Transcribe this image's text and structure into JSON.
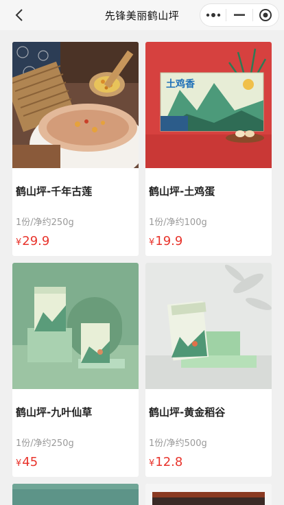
{
  "navbar": {
    "title": "先锋美丽鹤山坪",
    "back_icon": "chevron-left-icon",
    "more_icon": "more-dots-icon",
    "minimize_icon": "minus-icon",
    "close_icon": "target-circle-icon"
  },
  "products": [
    {
      "name": "鹤山坪-千年古莲",
      "spec": "1份/净约250g",
      "currency": "¥",
      "price": "29.9"
    },
    {
      "name": "鹤山坪-土鸡蛋",
      "spec": "1份/净约100g",
      "currency": "¥",
      "price": "19.9",
      "box_text": "土鸡香"
    },
    {
      "name": "鹤山坪-九叶仙草",
      "spec": "1份/净约250g",
      "currency": "¥",
      "price": "45"
    },
    {
      "name": "鹤山坪-黄金稻谷",
      "spec": "1份/净约500g",
      "currency": "¥",
      "price": "12.8"
    }
  ],
  "colors": {
    "price": "#e8332b",
    "background": "#f0f0f0",
    "card": "#ffffff"
  }
}
